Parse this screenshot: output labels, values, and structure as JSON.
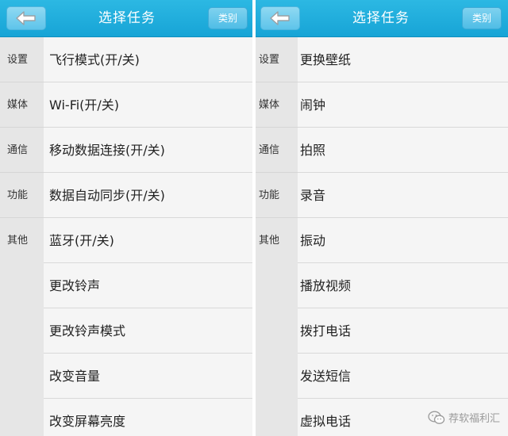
{
  "left_panel": {
    "header": {
      "title": "选择任务",
      "category_label": "类别"
    },
    "sidebar": {
      "items": [
        "设置",
        "媒体",
        "通信",
        "功能",
        "其他"
      ]
    },
    "list": {
      "items": [
        "飞行模式(开/关)",
        "Wi-Fi(开/关)",
        "移动数据连接(开/关)",
        "数据自动同步(开/关)",
        "蓝牙(开/关)",
        "更改铃声",
        "更改铃声模式",
        "改变音量",
        "改变屏幕亮度"
      ]
    }
  },
  "right_panel": {
    "header": {
      "title": "选择任务",
      "category_label": "类别"
    },
    "sidebar": {
      "items": [
        "设置",
        "媒体",
        "通信",
        "功能",
        "其他"
      ]
    },
    "list": {
      "items": [
        "更换壁纸",
        "闹钟",
        "拍照",
        "录音",
        "振动",
        "播放视频",
        "拨打电话",
        "发送短信",
        "虚拟电话"
      ]
    }
  },
  "watermark": {
    "text": "荐软福利汇",
    "icon": "wechat-icon"
  },
  "colors": {
    "header_bg": "#1aa8da",
    "sidebar_bg": "#e6e6e6",
    "list_bg": "#f5f5f5",
    "divider": "#d9d9d9"
  }
}
